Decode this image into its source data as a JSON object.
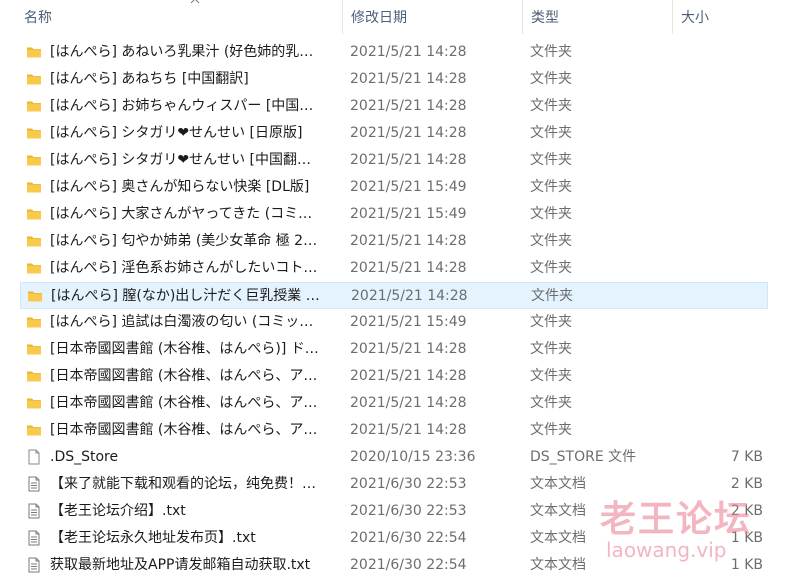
{
  "columns": {
    "name": "名称",
    "date": "修改日期",
    "type": "类型",
    "size": "大小"
  },
  "files": [
    {
      "kind": "folder",
      "name": "[はんぺら] あねいろ乳果汁 (好色姉的乳…",
      "date": "2021/5/21 14:28",
      "type": "文件夹",
      "size": ""
    },
    {
      "kind": "folder",
      "name": "[はんぺら] あねちち [中国翻訳]",
      "date": "2021/5/21 14:28",
      "type": "文件夹",
      "size": ""
    },
    {
      "kind": "folder",
      "name": "[はんぺら] お姉ちゃんウィスパー [中国…",
      "date": "2021/5/21 14:28",
      "type": "文件夹",
      "size": ""
    },
    {
      "kind": "folder",
      "name": "[はんぺら] シタガリ❤せんせい [日原版]",
      "date": "2021/5/21 14:28",
      "type": "文件夹",
      "size": ""
    },
    {
      "kind": "folder",
      "name": "[はんぺら] シタガリ❤せんせい [中国翻…",
      "date": "2021/5/21 14:28",
      "type": "文件夹",
      "size": ""
    },
    {
      "kind": "folder",
      "name": "[はんぺら] 奥さんが知らない快楽 [DL版]",
      "date": "2021/5/21 15:49",
      "type": "文件夹",
      "size": ""
    },
    {
      "kind": "folder",
      "name": "[はんぺら] 大家さんがヤってきた (コミ…",
      "date": "2021/5/21 15:49",
      "type": "文件夹",
      "size": ""
    },
    {
      "kind": "folder",
      "name": "[はんぺら] 匂やか姉弟 (美少女革命 極 2…",
      "date": "2021/5/21 14:28",
      "type": "文件夹",
      "size": ""
    },
    {
      "kind": "folder",
      "name": "[はんぺら] 淫色系お姉さんがしたいコト…",
      "date": "2021/5/21 14:28",
      "type": "文件夹",
      "size": ""
    },
    {
      "kind": "folder",
      "name": "[はんぺら] 膣(なか)出し汁だく巨乳授業 …",
      "date": "2021/5/21 14:28",
      "type": "文件夹",
      "size": "",
      "selected": true
    },
    {
      "kind": "folder",
      "name": "[はんぺら] 追試は白濁液の匂い (コミッ…",
      "date": "2021/5/21 15:49",
      "type": "文件夹",
      "size": ""
    },
    {
      "kind": "folder",
      "name": "[日本帝國図書館 (木谷椎、はんぺら)] ド…",
      "date": "2021/5/21 14:28",
      "type": "文件夹",
      "size": ""
    },
    {
      "kind": "folder",
      "name": "[日本帝國図書館 (木谷椎、はんぺら、ア…",
      "date": "2021/5/21 14:28",
      "type": "文件夹",
      "size": ""
    },
    {
      "kind": "folder",
      "name": "[日本帝國図書館 (木谷椎、はんぺら、ア…",
      "date": "2021/5/21 14:28",
      "type": "文件夹",
      "size": ""
    },
    {
      "kind": "folder",
      "name": "[日本帝國図書館 (木谷椎、はんぺら、ア…",
      "date": "2021/5/21 14:28",
      "type": "文件夹",
      "size": ""
    },
    {
      "kind": "file",
      "name": ".DS_Store",
      "date": "2020/10/15 23:36",
      "type": "DS_STORE 文件",
      "size": "7 KB"
    },
    {
      "kind": "text",
      "name": "【来了就能下载和观看的论坛，纯免费！…",
      "date": "2021/6/30 22:53",
      "type": "文本文档",
      "size": "2 KB"
    },
    {
      "kind": "text",
      "name": "【老王论坛介绍】.txt",
      "date": "2021/6/30 22:53",
      "type": "文本文档",
      "size": "2 KB"
    },
    {
      "kind": "text",
      "name": "【老王论坛永久地址发布页】.txt",
      "date": "2021/6/30 22:54",
      "type": "文本文档",
      "size": "1 KB"
    },
    {
      "kind": "text",
      "name": "获取最新地址及APP请发邮箱自动获取.txt",
      "date": "2021/6/30 22:54",
      "type": "文本文档",
      "size": "1 KB"
    }
  ],
  "watermark": {
    "text": "老王论坛",
    "url": "laowang.vip"
  },
  "colors": {
    "folder": "#f8c94a",
    "header_text": "#4c607a",
    "meta_text": "#6d6d6d",
    "selection_bg": "#e5f3ff",
    "watermark": "#e9788c"
  }
}
